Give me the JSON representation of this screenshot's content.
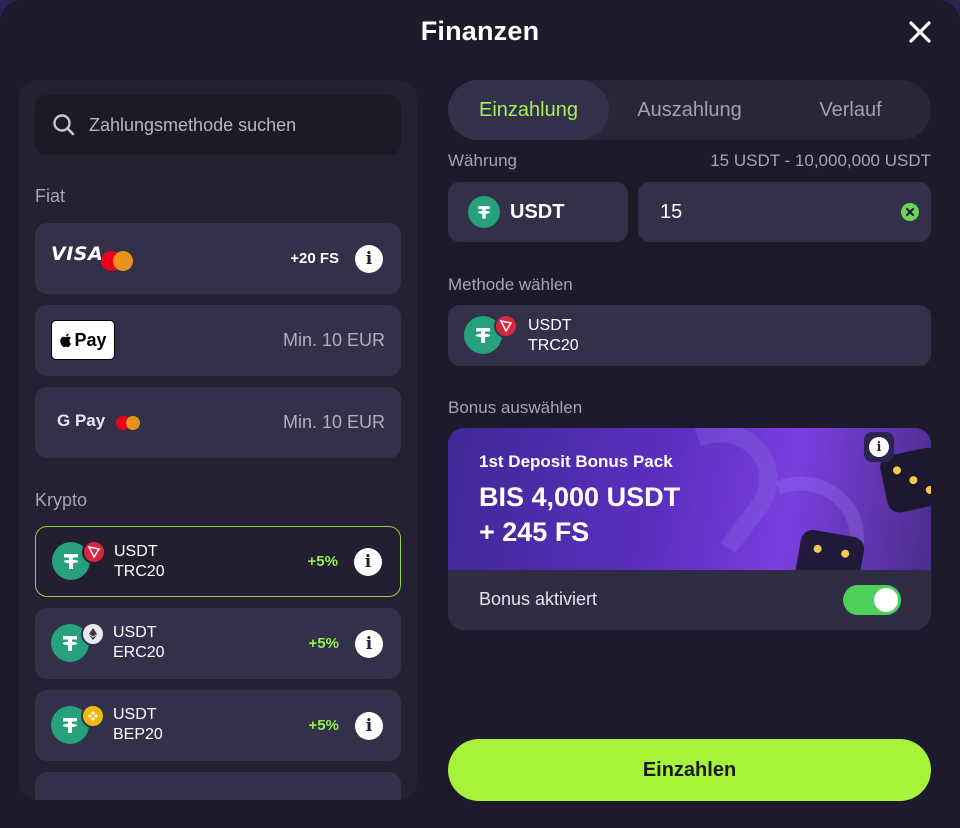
{
  "modal": {
    "title": "Finanzen"
  },
  "search": {
    "placeholder": "Zahlungsmethode suchen"
  },
  "left": {
    "fiat_label": "Fiat",
    "crypto_label": "Krypto",
    "fiat_methods": [
      {
        "name": "VISA",
        "badge": "+20 FS"
      },
      {
        "name": "Pay",
        "min": "Min. 10 EUR"
      },
      {
        "name": "G Pay",
        "min": "Min. 10 EUR"
      }
    ],
    "crypto_methods": [
      {
        "coin": "USDT",
        "network": "TRC20",
        "bonus": "+5%"
      },
      {
        "coin": "USDT",
        "network": "ERC20",
        "bonus": "+5%"
      },
      {
        "coin": "USDT",
        "network": "BEP20",
        "bonus": "+5%"
      }
    ]
  },
  "tabs": [
    "Einzahlung",
    "Auszahlung",
    "Verlauf"
  ],
  "currency": {
    "label": "Währung",
    "range": "15 USDT - 10,000,000 USDT",
    "selected": "USDT",
    "amount": "15"
  },
  "method": {
    "label": "Methode wählen",
    "coin": "USDT",
    "network": "TRC20"
  },
  "bonus": {
    "label": "Bonus auswählen",
    "pack_title": "1st Deposit Bonus Pack",
    "headline_1": "BIS 4,000 USDT",
    "headline_2": "+ 245 FS",
    "toggle_label": "Bonus aktiviert",
    "active": true
  },
  "deposit_button": "Einzahlen",
  "colors": {
    "accent": "#a6f33a",
    "tether": "#26a17b",
    "tron": "#d7263d",
    "bnb": "#f0b90b"
  }
}
